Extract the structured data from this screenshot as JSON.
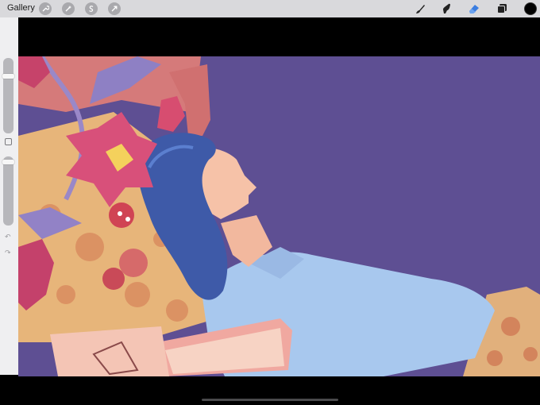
{
  "toolbar": {
    "gallery_label": "Gallery",
    "left_tools": [
      "wrench-icon",
      "magic-wand-icon",
      "selection-s-icon",
      "transform-arrow-icon"
    ],
    "right_tools": [
      "brush-icon",
      "smudge-icon",
      "eraser-icon",
      "layers-icon"
    ],
    "active_tool": "eraser-icon",
    "current_color": "#000000"
  },
  "sidebar": {
    "brush_size_level": 0.78,
    "opacity_level": 0.05
  },
  "canvas": {
    "background": "#5e4f93"
  }
}
